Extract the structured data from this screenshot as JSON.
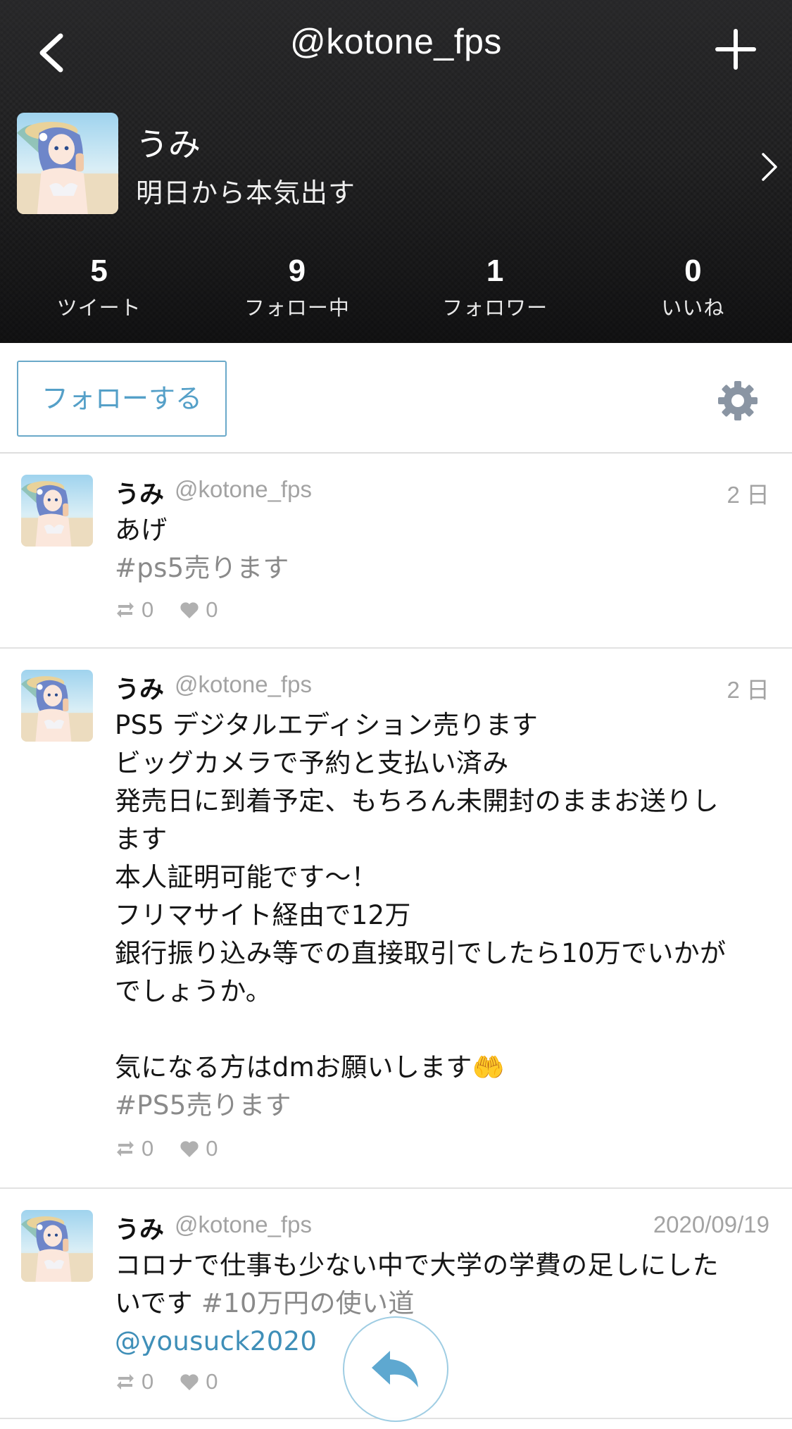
{
  "header": {
    "title": "@kotone_fps",
    "back_icon": "chevron-left-icon",
    "add_icon": "plus-icon"
  },
  "profile": {
    "display_name": "うみ",
    "bio": "明日から本気出す",
    "stats": [
      {
        "count": "5",
        "label": "ツイート"
      },
      {
        "count": "9",
        "label": "フォロー中"
      },
      {
        "count": "1",
        "label": "フォロワー"
      },
      {
        "count": "0",
        "label": "いいね"
      }
    ]
  },
  "actions": {
    "follow_label": "フォローする",
    "settings_icon": "gear-icon"
  },
  "tweets": [
    {
      "name": "うみ",
      "handle": "@kotone_fps",
      "time": "2 日",
      "text": "あげ",
      "hashtag": "#ps5売ります",
      "retweets": "0",
      "likes": "0"
    },
    {
      "name": "うみ",
      "handle": "@kotone_fps",
      "time": "2 日",
      "text": "PS5 デジタルエディション売ります\nビッグカメラで予約と支払い済み\n発売日に到着予定、もちろん未開封のままお送りし\nます\n本人証明可能です〜！\nフリマサイト経由で12万\n銀行振り込み等での直接取引でしたら10万でいかが\nでしょうか。\n\n気になる方はdmお願いします🤲",
      "hashtag": "#PS5売ります",
      "retweets": "0",
      "likes": "0"
    },
    {
      "name": "うみ",
      "handle": "@kotone_fps",
      "time": "2020/09/19",
      "text": "コロナで仕事も少ない中で大学の学費の足しにした\nいです ",
      "hashtag": "#10万円の使い道",
      "mention": "@yousuck2020",
      "retweets": "0",
      "likes": "0"
    }
  ],
  "fab": {
    "icon": "reply-icon"
  },
  "colors": {
    "accent": "#55a0c8",
    "header_bg": "#1e1e1f",
    "muted": "#a3a3a3"
  }
}
